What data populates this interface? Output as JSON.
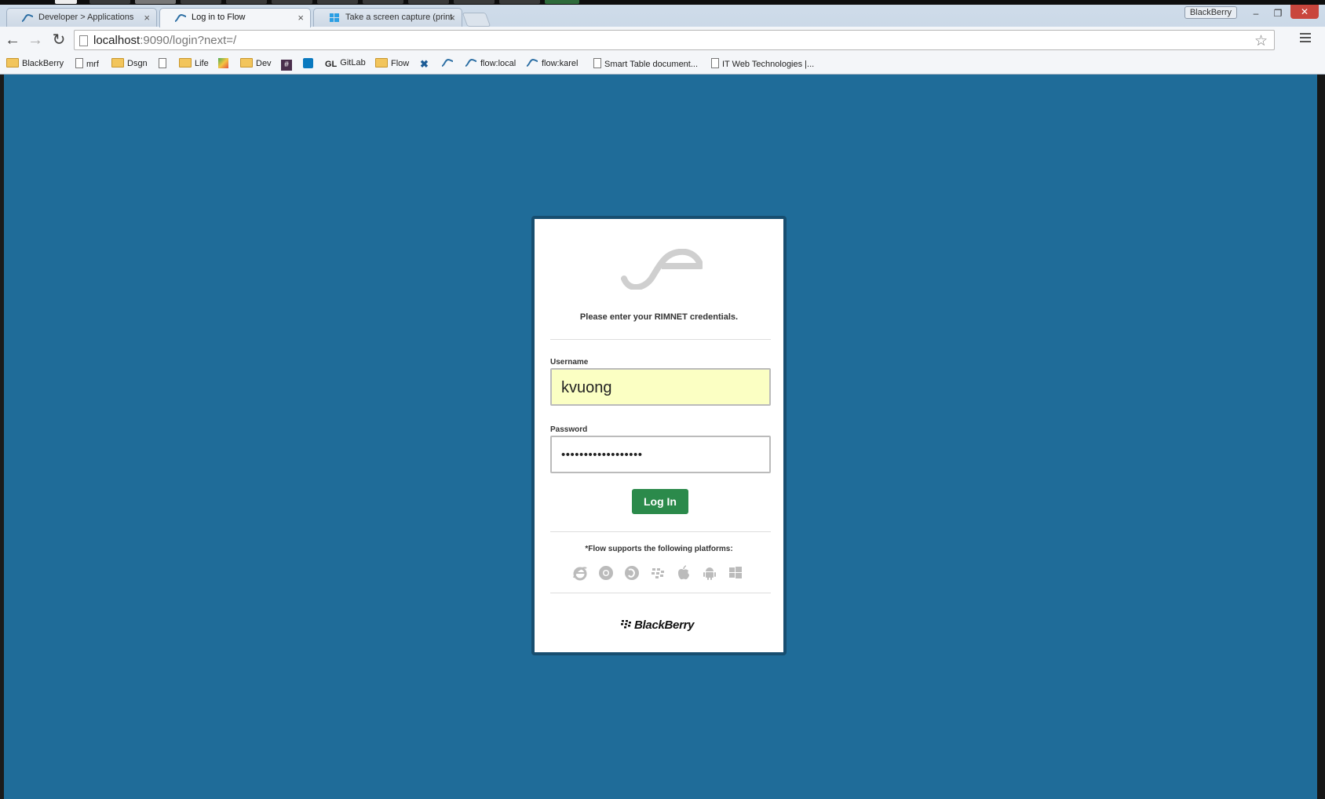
{
  "tabs": [
    {
      "label": "Developer > Applications",
      "active": false
    },
    {
      "label": "Log in to Flow",
      "active": true
    },
    {
      "label": "Take a screen capture (print",
      "active": false
    }
  ],
  "window": {
    "profile": "BlackBerry"
  },
  "address_bar": {
    "host": "localhost",
    "rest": ":9090/login?next=/"
  },
  "bookmarks": [
    {
      "label": "BlackBerry",
      "icon": "folder-icon"
    },
    {
      "label": "mrf",
      "icon": "page-icon"
    },
    {
      "label": "Dsgn",
      "icon": "folder-icon"
    },
    {
      "label": "",
      "icon": "page-icon"
    },
    {
      "label": "Life",
      "icon": "folder-icon"
    },
    {
      "label": "",
      "icon": "maps-icon"
    },
    {
      "label": "Dev",
      "icon": "folder-icon"
    },
    {
      "label": "",
      "icon": "slack-icon"
    },
    {
      "label": "",
      "icon": "trello-icon"
    },
    {
      "label": "GitLab",
      "icon": "gitlab-icon"
    },
    {
      "label": "Flow",
      "icon": "folder-icon"
    },
    {
      "label": "",
      "icon": "tools-icon"
    },
    {
      "label": "",
      "icon": "flow-icon"
    },
    {
      "label": "flow:local",
      "icon": "flow-icon"
    },
    {
      "label": "flow:karel",
      "icon": "flow-icon"
    },
    {
      "label": "Smart Table document...",
      "icon": "page-icon"
    },
    {
      "label": "IT Web Technologies |...",
      "icon": "page-icon"
    }
  ],
  "login": {
    "prompt": "Please enter your RIMNET credentials.",
    "username_label": "Username",
    "username_value": "kvuong",
    "password_label": "Password",
    "password_value": "••••••••••••••••••",
    "submit_label": "Log In",
    "platforms_text": "*Flow supports the following platforms:",
    "platforms": [
      "ie-icon",
      "chrome-icon",
      "firefox-icon",
      "blackberry-icon",
      "apple-icon",
      "android-icon",
      "windows-icon"
    ],
    "brand": "BlackBerry"
  },
  "colors": {
    "background": "#1f6c99",
    "button": "#2b8a4b",
    "autofill": "#fbffc3"
  }
}
